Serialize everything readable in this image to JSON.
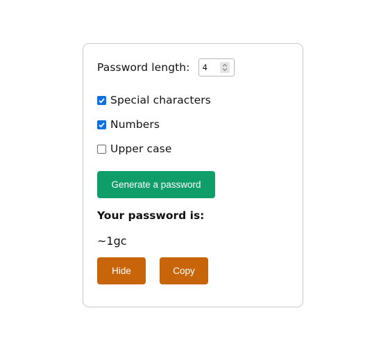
{
  "form": {
    "length_label": "Password length:",
    "length_value": "4",
    "options": [
      {
        "label": "Special characters",
        "checked": true
      },
      {
        "label": "Numbers",
        "checked": true
      },
      {
        "label": "Upper case",
        "checked": false
      }
    ],
    "generate_label": "Generate a password"
  },
  "result": {
    "title": "Your password is:",
    "password": "~1gc",
    "hide_label": "Hide",
    "copy_label": "Copy"
  },
  "colors": {
    "generate_button": "#0f9d6a",
    "action_buttons": "#c8650a",
    "checkbox_checked": "#0f6fde"
  }
}
